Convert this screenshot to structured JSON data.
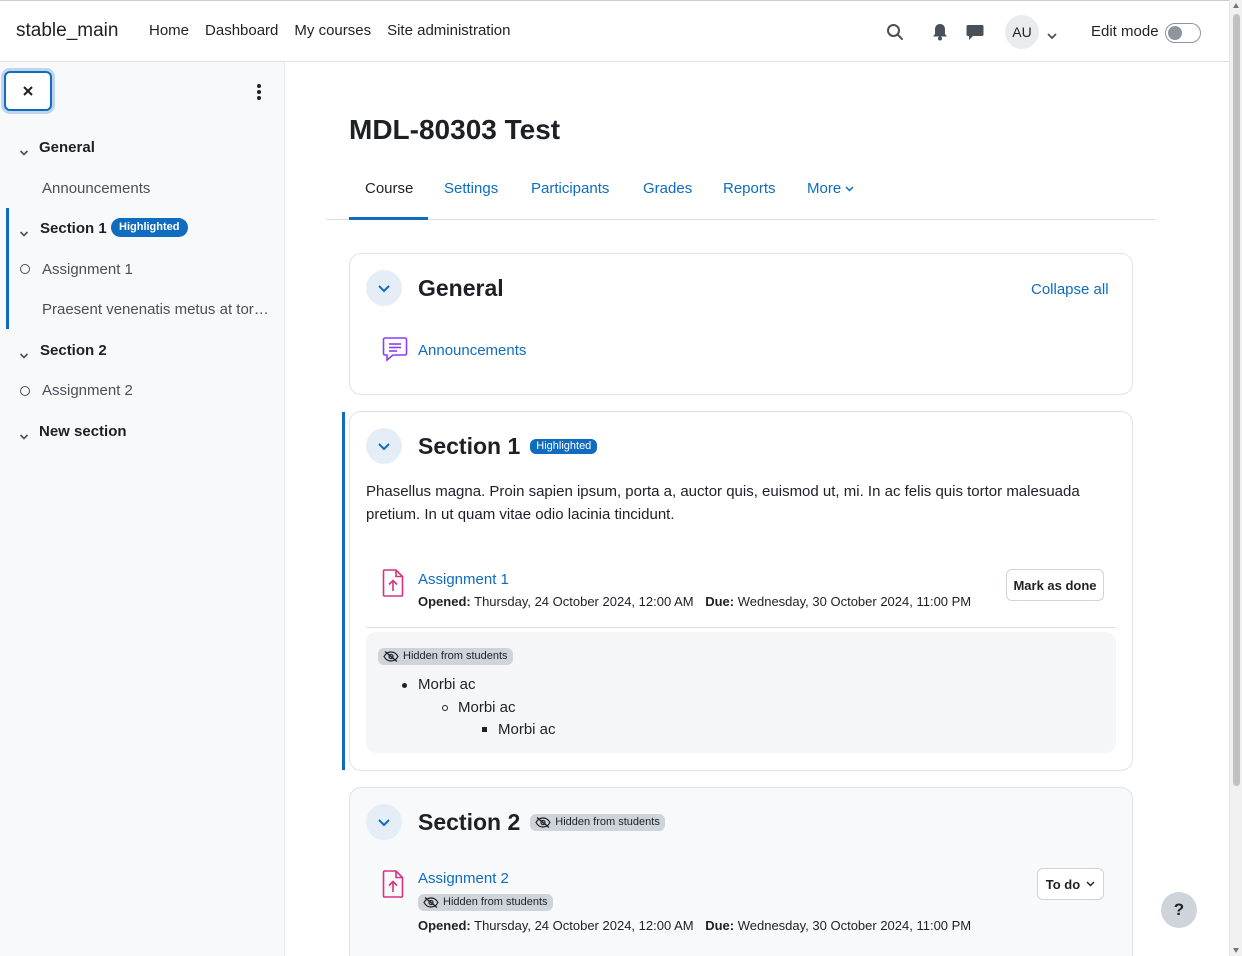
{
  "navbar": {
    "brand": "stable_main",
    "links": [
      "Home",
      "Dashboard",
      "My courses",
      "Site administration"
    ],
    "avatar_initials": "AU",
    "edit_mode_label": "Edit mode"
  },
  "drawer": {
    "items": [
      {
        "label": "General",
        "type": "section"
      },
      {
        "label": "Announcements",
        "type": "activity"
      },
      {
        "label": "Section 1",
        "type": "section",
        "badge": "Highlighted"
      },
      {
        "label": "Assignment 1",
        "type": "activity-completion"
      },
      {
        "label": "Praesent venenatis metus at tortor pulvinar varius.",
        "type": "activity"
      },
      {
        "label": "Section 2",
        "type": "section"
      },
      {
        "label": "Assignment 2",
        "type": "activity-completion"
      },
      {
        "label": "New section",
        "type": "section"
      }
    ]
  },
  "course": {
    "title": "MDL-80303 Test",
    "tabs": [
      "Course",
      "Settings",
      "Participants",
      "Grades",
      "Reports",
      "More"
    ],
    "collapse_all": "Collapse all"
  },
  "sections": {
    "general": {
      "title": "General",
      "activity": "Announcements"
    },
    "section1": {
      "title": "Section 1",
      "badge": "Highlighted",
      "summary": "Phasellus magna. Proin sapien ipsum, porta a, auctor quis, euismod ut, mi. In ac felis quis tortor malesuada pretium. In ut quam vitae odio lacinia tincidunt.",
      "assignment": {
        "name": "Assignment 1",
        "opened_label": "Opened:",
        "opened": "Thursday, 24 October 2024, 12:00 AM",
        "due_label": "Due:",
        "due": "Wednesday, 30 October 2024, 11:00 PM",
        "button": "Mark as done"
      },
      "label_block": {
        "badge": "Hidden from students",
        "list_level1": "Morbi ac",
        "list_level2": "Morbi ac",
        "list_level3": "Morbi ac"
      }
    },
    "section2": {
      "title": "Section 2",
      "badge": "Hidden from students",
      "assignment": {
        "name": "Assignment 2",
        "badge": "Hidden from students",
        "opened_label": "Opened:",
        "opened": "Thursday, 24 October 2024, 12:00 AM",
        "due_label": "Due:",
        "due": "Wednesday, 30 October 2024, 11:00 PM",
        "button": "To do"
      }
    }
  },
  "help": "?",
  "colors": {
    "primary": "#0f6cbf",
    "assign_icon": "#d63384",
    "forum_icon": "#8a3ffc"
  }
}
